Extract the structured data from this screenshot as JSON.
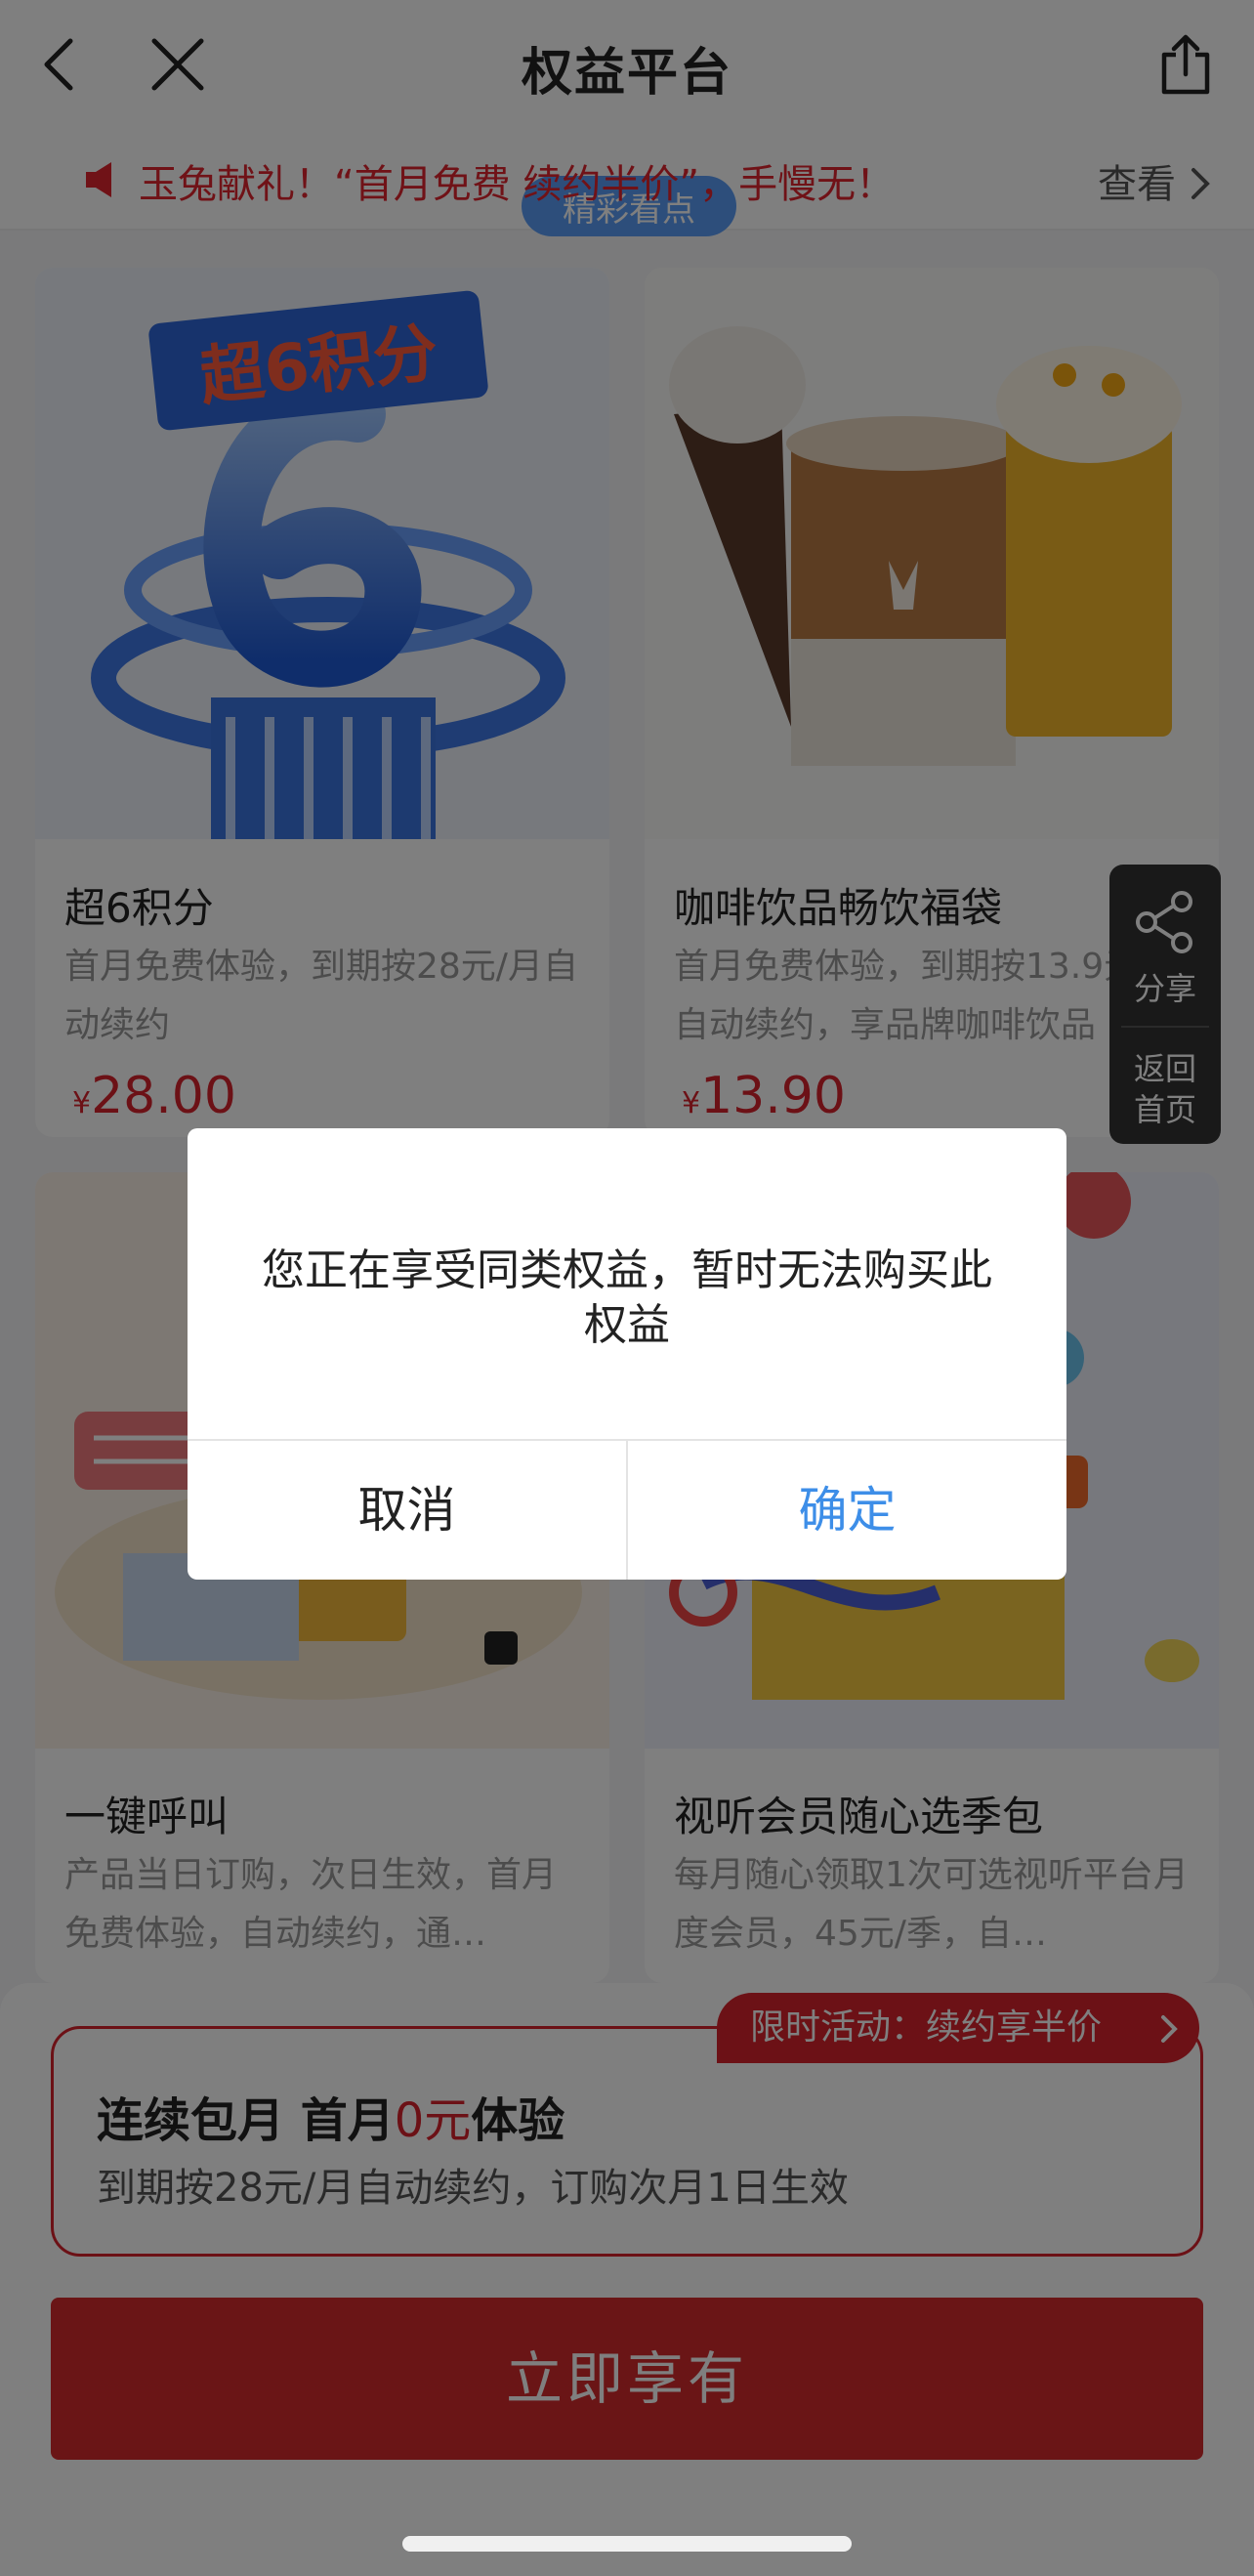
{
  "nav": {
    "title": "权益平台"
  },
  "notice": {
    "text": "玉兔献礼！“首月免费 续约半价”，手慢无！",
    "more": "查看",
    "pill": "精彩看点"
  },
  "cards": [
    {
      "name": "超6积分",
      "desc": "首月免费体验，到期按28元/月自动续约",
      "currency": "¥",
      "price": "28.00",
      "image_text": "超6积分"
    },
    {
      "name": "咖啡饮品畅饮福袋",
      "desc": "首月免费体验，到期按13.9元/月自动续约，享品牌咖啡饮品",
      "currency": "¥",
      "price": "13.90"
    },
    {
      "name": "一键呼叫",
      "desc": "产品当日订购，次日生效，首月免费体验，自动续约，通…"
    },
    {
      "name": "视听会员随心选季包",
      "desc": "每月随心领取1次可选视听平台月度会员，45元/季，自…"
    }
  ],
  "float": {
    "share": "分享",
    "home": "返回\n首页"
  },
  "plan": {
    "head_prefix": "连续包月 首月",
    "head_highlight": "0元",
    "head_suffix": "体验",
    "sub": "到期按28元/月自动续约，订购次月1日生效"
  },
  "promo": {
    "label": "限时活动：续约享半价"
  },
  "cta": {
    "label": "立即享有"
  },
  "dialog": {
    "message": "您正在享受同类权益，暂时无法购买此权益",
    "cancel": "取消",
    "confirm": "确定"
  },
  "colors": {
    "brand_red": "#d9232d",
    "link_blue": "#3d8ee8",
    "overlay": "rgba(0,0,0,0.5)"
  }
}
